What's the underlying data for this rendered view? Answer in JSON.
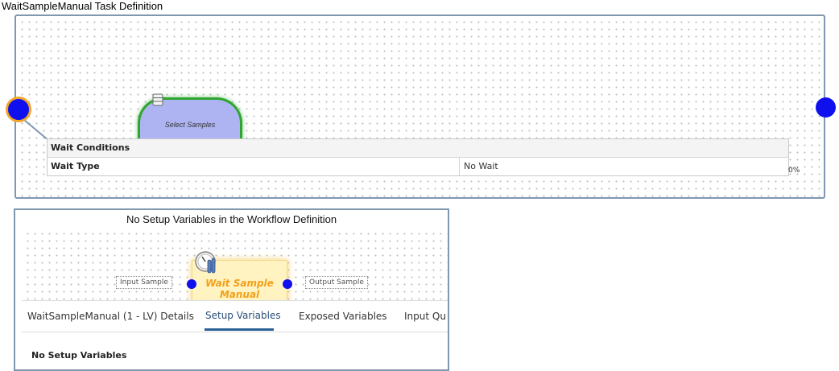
{
  "page": {
    "title": "WaitSampleManual Task Definition"
  },
  "task_canvas": {
    "nodes": {
      "select_samples": "Select Samples"
    },
    "wait_conditions": {
      "header": "Wait Conditions",
      "wait_type_label": "Wait Type",
      "wait_type_value": "No Wait"
    },
    "percent_fragment": "0%"
  },
  "workflow_panel": {
    "title": "No Setup Variables in the Workflow Definition",
    "input_label": "Input Sample",
    "output_label": "Output Sample",
    "node_label": "Wait Sample Manual",
    "tabs": [
      {
        "label": "WaitSampleManual (1 - LV) Details",
        "selected": false
      },
      {
        "label": "Setup Variables",
        "selected": true
      },
      {
        "label": "Exposed Variables",
        "selected": false
      },
      {
        "label": "Input Qu",
        "selected": false
      }
    ],
    "empty_message": "No Setup Variables"
  },
  "colors": {
    "node_blue": "#1010ee",
    "selection_orange": "#f0a52a",
    "node_green_border": "#2fa52f",
    "select_fill": "#aeb4f2",
    "wait_node_text": "#f2a019",
    "tab_active": "#2c5f95"
  },
  "icons": {
    "database": "database-icon",
    "clock": "clock-icon",
    "play": "play-icon"
  }
}
